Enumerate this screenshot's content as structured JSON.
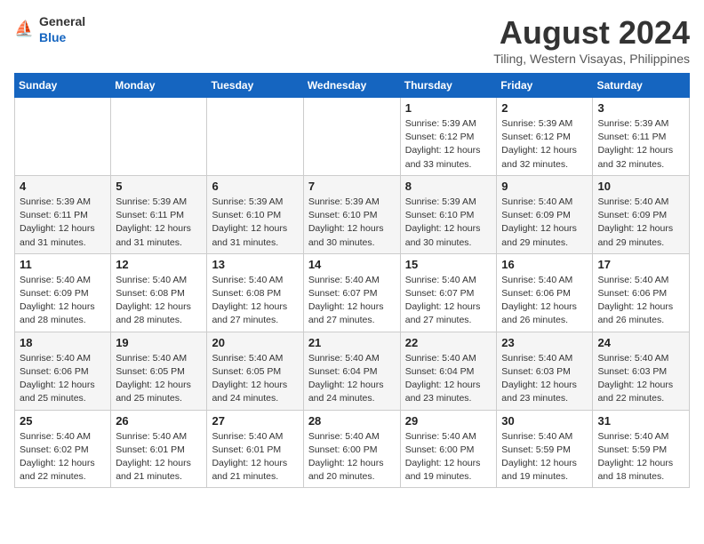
{
  "logo": {
    "general": "General",
    "blue": "Blue"
  },
  "title": "August 2024",
  "subtitle": "Tiling, Western Visayas, Philippines",
  "days_of_week": [
    "Sunday",
    "Monday",
    "Tuesday",
    "Wednesday",
    "Thursday",
    "Friday",
    "Saturday"
  ],
  "weeks": [
    [
      {
        "day": "",
        "info": ""
      },
      {
        "day": "",
        "info": ""
      },
      {
        "day": "",
        "info": ""
      },
      {
        "day": "",
        "info": ""
      },
      {
        "day": "1",
        "info": "Sunrise: 5:39 AM\nSunset: 6:12 PM\nDaylight: 12 hours\nand 33 minutes."
      },
      {
        "day": "2",
        "info": "Sunrise: 5:39 AM\nSunset: 6:12 PM\nDaylight: 12 hours\nand 32 minutes."
      },
      {
        "day": "3",
        "info": "Sunrise: 5:39 AM\nSunset: 6:11 PM\nDaylight: 12 hours\nand 32 minutes."
      }
    ],
    [
      {
        "day": "4",
        "info": "Sunrise: 5:39 AM\nSunset: 6:11 PM\nDaylight: 12 hours\nand 31 minutes."
      },
      {
        "day": "5",
        "info": "Sunrise: 5:39 AM\nSunset: 6:11 PM\nDaylight: 12 hours\nand 31 minutes."
      },
      {
        "day": "6",
        "info": "Sunrise: 5:39 AM\nSunset: 6:10 PM\nDaylight: 12 hours\nand 31 minutes."
      },
      {
        "day": "7",
        "info": "Sunrise: 5:39 AM\nSunset: 6:10 PM\nDaylight: 12 hours\nand 30 minutes."
      },
      {
        "day": "8",
        "info": "Sunrise: 5:39 AM\nSunset: 6:10 PM\nDaylight: 12 hours\nand 30 minutes."
      },
      {
        "day": "9",
        "info": "Sunrise: 5:40 AM\nSunset: 6:09 PM\nDaylight: 12 hours\nand 29 minutes."
      },
      {
        "day": "10",
        "info": "Sunrise: 5:40 AM\nSunset: 6:09 PM\nDaylight: 12 hours\nand 29 minutes."
      }
    ],
    [
      {
        "day": "11",
        "info": "Sunrise: 5:40 AM\nSunset: 6:09 PM\nDaylight: 12 hours\nand 28 minutes."
      },
      {
        "day": "12",
        "info": "Sunrise: 5:40 AM\nSunset: 6:08 PM\nDaylight: 12 hours\nand 28 minutes."
      },
      {
        "day": "13",
        "info": "Sunrise: 5:40 AM\nSunset: 6:08 PM\nDaylight: 12 hours\nand 27 minutes."
      },
      {
        "day": "14",
        "info": "Sunrise: 5:40 AM\nSunset: 6:07 PM\nDaylight: 12 hours\nand 27 minutes."
      },
      {
        "day": "15",
        "info": "Sunrise: 5:40 AM\nSunset: 6:07 PM\nDaylight: 12 hours\nand 27 minutes."
      },
      {
        "day": "16",
        "info": "Sunrise: 5:40 AM\nSunset: 6:06 PM\nDaylight: 12 hours\nand 26 minutes."
      },
      {
        "day": "17",
        "info": "Sunrise: 5:40 AM\nSunset: 6:06 PM\nDaylight: 12 hours\nand 26 minutes."
      }
    ],
    [
      {
        "day": "18",
        "info": "Sunrise: 5:40 AM\nSunset: 6:06 PM\nDaylight: 12 hours\nand 25 minutes."
      },
      {
        "day": "19",
        "info": "Sunrise: 5:40 AM\nSunset: 6:05 PM\nDaylight: 12 hours\nand 25 minutes."
      },
      {
        "day": "20",
        "info": "Sunrise: 5:40 AM\nSunset: 6:05 PM\nDaylight: 12 hours\nand 24 minutes."
      },
      {
        "day": "21",
        "info": "Sunrise: 5:40 AM\nSunset: 6:04 PM\nDaylight: 12 hours\nand 24 minutes."
      },
      {
        "day": "22",
        "info": "Sunrise: 5:40 AM\nSunset: 6:04 PM\nDaylight: 12 hours\nand 23 minutes."
      },
      {
        "day": "23",
        "info": "Sunrise: 5:40 AM\nSunset: 6:03 PM\nDaylight: 12 hours\nand 23 minutes."
      },
      {
        "day": "24",
        "info": "Sunrise: 5:40 AM\nSunset: 6:03 PM\nDaylight: 12 hours\nand 22 minutes."
      }
    ],
    [
      {
        "day": "25",
        "info": "Sunrise: 5:40 AM\nSunset: 6:02 PM\nDaylight: 12 hours\nand 22 minutes."
      },
      {
        "day": "26",
        "info": "Sunrise: 5:40 AM\nSunset: 6:01 PM\nDaylight: 12 hours\nand 21 minutes."
      },
      {
        "day": "27",
        "info": "Sunrise: 5:40 AM\nSunset: 6:01 PM\nDaylight: 12 hours\nand 21 minutes."
      },
      {
        "day": "28",
        "info": "Sunrise: 5:40 AM\nSunset: 6:00 PM\nDaylight: 12 hours\nand 20 minutes."
      },
      {
        "day": "29",
        "info": "Sunrise: 5:40 AM\nSunset: 6:00 PM\nDaylight: 12 hours\nand 19 minutes."
      },
      {
        "day": "30",
        "info": "Sunrise: 5:40 AM\nSunset: 5:59 PM\nDaylight: 12 hours\nand 19 minutes."
      },
      {
        "day": "31",
        "info": "Sunrise: 5:40 AM\nSunset: 5:59 PM\nDaylight: 12 hours\nand 18 minutes."
      }
    ]
  ]
}
